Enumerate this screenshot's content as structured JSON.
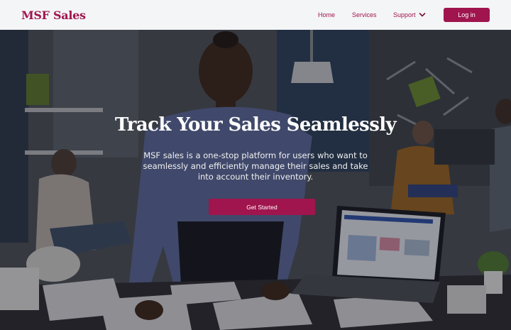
{
  "brand": {
    "name": "MSF Sales"
  },
  "nav": {
    "home": "Home",
    "services": "Services",
    "support": "Support",
    "login": "Log in"
  },
  "hero": {
    "title": "Track Your Sales Seamlessly",
    "description": "MSF sales is a one-stop platform for users who want to seamlessly and efficiently manage their sales and take into account their inventory.",
    "cta": "Get Started"
  },
  "colors": {
    "brand": "#a0154d",
    "header_bg": "#f4f5f7"
  },
  "icons": {
    "support_dropdown": "chevron-down-icon"
  }
}
